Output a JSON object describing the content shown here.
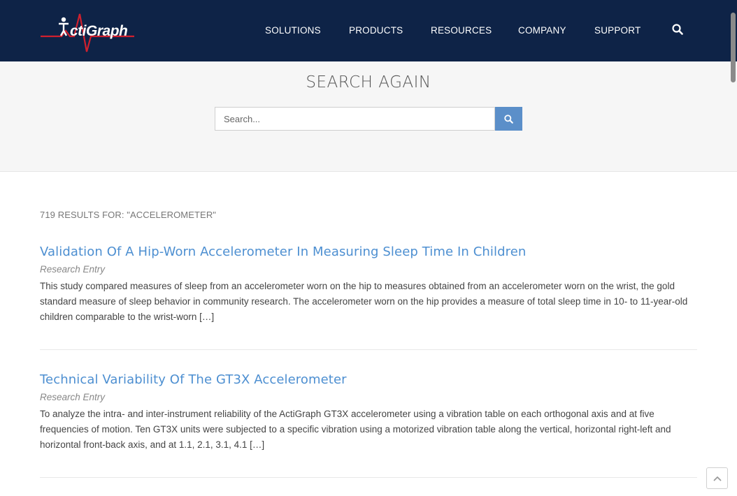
{
  "nav": {
    "logo_text": "ActiGraph",
    "items": [
      {
        "label": "SOLUTIONS"
      },
      {
        "label": "PRODUCTS"
      },
      {
        "label": "RESOURCES"
      },
      {
        "label": "COMPANY"
      },
      {
        "label": "SUPPORT"
      }
    ],
    "search_icon": "search-icon"
  },
  "hero": {
    "title": "SEARCH AGAIN",
    "search_placeholder": "Search...",
    "search_value": ""
  },
  "results": {
    "count_text": "719 RESULTS FOR: \"ACCELEROMETER\"",
    "items": [
      {
        "title": "Validation Of A Hip-Worn Accelerometer In Measuring Sleep Time In Children",
        "type": "Research Entry",
        "excerpt": "This study compared measures of sleep from an accelerometer worn on the hip to measures obtained from an accelerometer worn on the wrist, the gold standard measure of sleep behavior in community research. The accelerometer worn on the hip provides a measure of total sleep time in 10- to 11-year-old children comparable to the wrist-worn […]"
      },
      {
        "title": "Technical Variability Of The GT3X Accelerometer",
        "type": "Research Entry",
        "excerpt": "To analyze the intra- and inter-instrument reliability of the ActiGraph GT3X accelerometer using a vibration table on each orthogonal axis and at five frequencies of motion. Ten GT3X units were subjected to a specific vibration using a motorized vibration table along the vertical, horizontal right-left and horizontal front-back axis, and at 1.1, 2.1, 3.1, 4.1 […]"
      }
    ]
  },
  "colors": {
    "navbar": "#0e2347",
    "link": "#4d8fd1",
    "search_button": "#5b8fc9",
    "logo_accent": "#d0202e"
  }
}
